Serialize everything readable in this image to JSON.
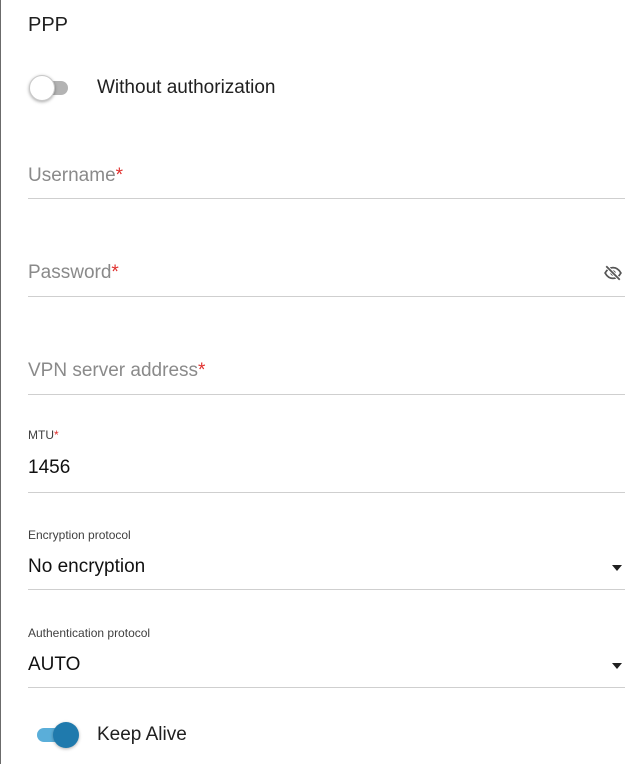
{
  "section": {
    "title": "PPP"
  },
  "without_auth": {
    "label": "Without authorization",
    "enabled": false
  },
  "username": {
    "placeholder": "Username",
    "required_mark": "*",
    "value": ""
  },
  "password": {
    "placeholder": "Password",
    "required_mark": "*",
    "value": "",
    "toggle_icon": "eye-off-icon"
  },
  "vpn_server": {
    "placeholder": "VPN server address",
    "required_mark": "*",
    "value": ""
  },
  "mtu": {
    "label": "MTU",
    "required_mark": "*",
    "value": "1456"
  },
  "encryption": {
    "label": "Encryption protocol",
    "value": "No encryption",
    "icon": "chevron-down-icon"
  },
  "authentication": {
    "label": "Authentication protocol",
    "value": "AUTO",
    "icon": "chevron-down-icon"
  },
  "keep_alive": {
    "label": "Keep Alive",
    "enabled": true
  },
  "colors": {
    "accent": "#1f7aad",
    "accent_track": "#5aaed9",
    "required": "#e0302e",
    "placeholder": "#8a8a8a",
    "divider": "#cfcfcf"
  }
}
